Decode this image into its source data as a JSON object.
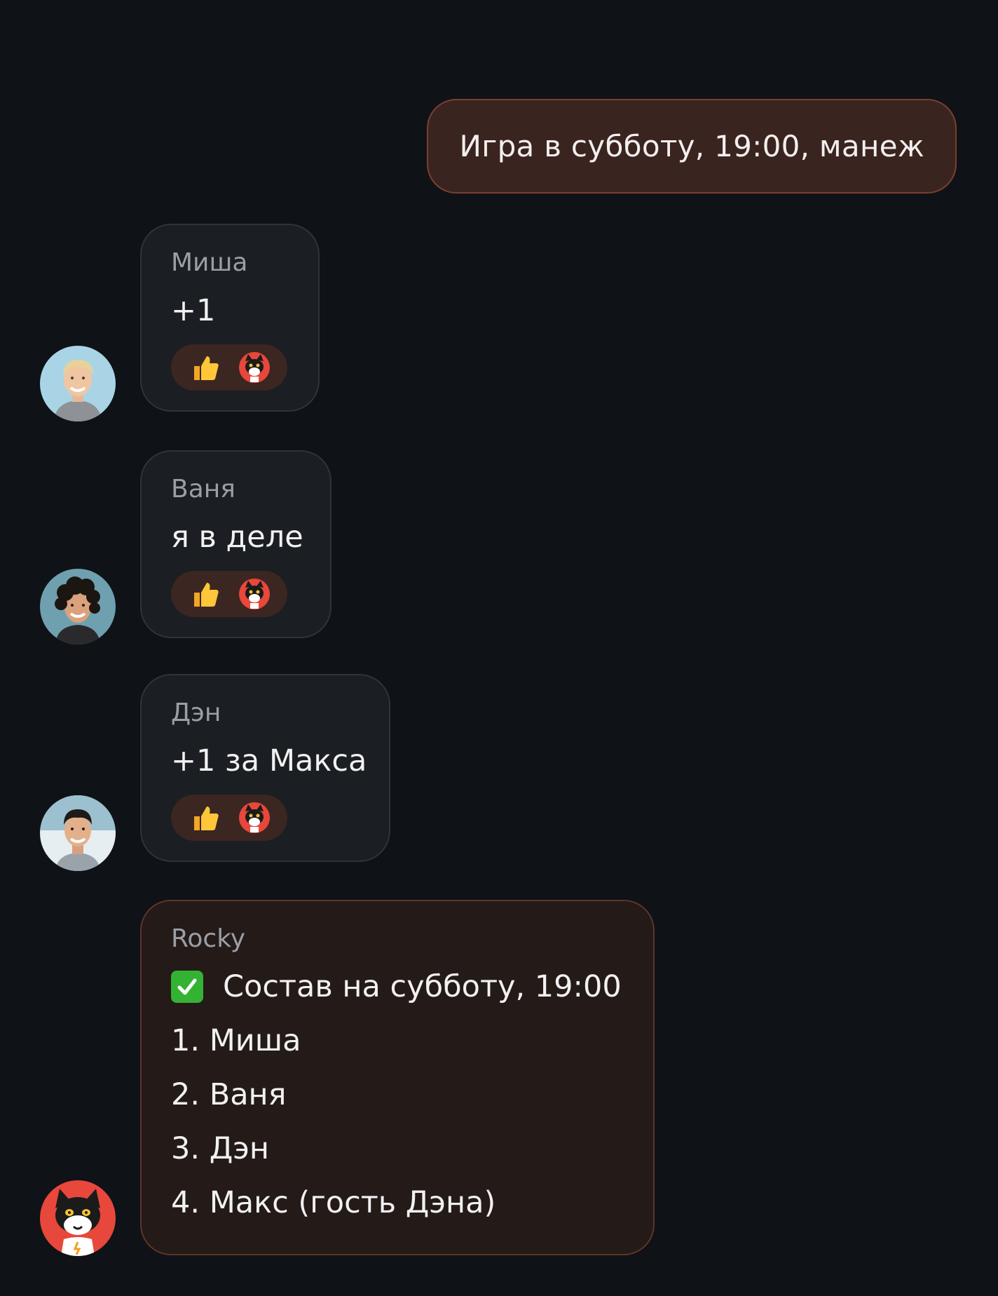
{
  "outgoing": {
    "text": "Игра в субботу, 19:00, манеж"
  },
  "messages": [
    {
      "sender": "Миша",
      "text": "+1",
      "reactions": [
        "thumbs-up-emoji",
        "cat-sticker-emoji"
      ],
      "avatar_icon": "avatar-blond-man"
    },
    {
      "sender": "Ваня",
      "text": "я в деле",
      "reactions": [
        "thumbs-up-emoji",
        "cat-sticker-emoji"
      ],
      "avatar_icon": "avatar-curly-hair-man"
    },
    {
      "sender": "Дэн",
      "text": "+1 за Макса",
      "reactions": [
        "thumbs-up-emoji",
        "cat-sticker-emoji"
      ],
      "avatar_icon": "avatar-dark-hair-man"
    }
  ],
  "bot": {
    "sender": "Rocky",
    "heading": "Состав на субботу, 19:00",
    "lines": [
      "1. Миша",
      "2. Ваня",
      "3. Дэн",
      "4. Макс (гость Дэна)"
    ],
    "avatar_icon": "avatar-cat-bot"
  },
  "colors": {
    "background": "#0f1217",
    "outgoing_bubble": "#3a2420",
    "incoming_bubble": "#1b1e23",
    "bot_bubble": "#241a18",
    "reaction_pill": "#3b2621",
    "check": "#34b233"
  }
}
